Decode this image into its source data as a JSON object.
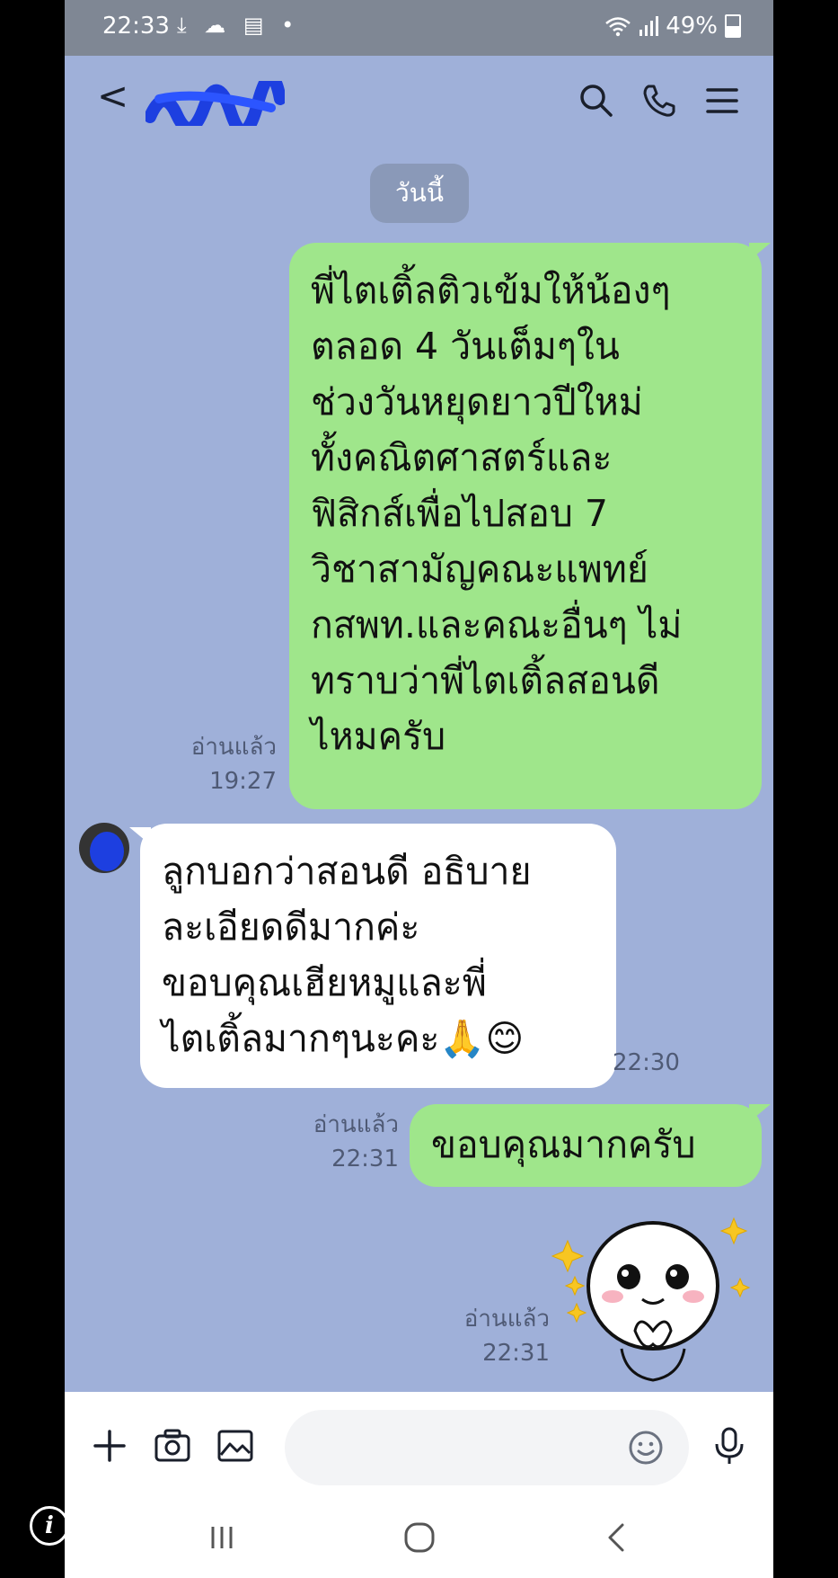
{
  "status_bar": {
    "time": "22:33",
    "left_icons": "⤓ ☁ ▤ •",
    "battery": "49%"
  },
  "header": {
    "back_glyph": "<"
  },
  "date_divider": "วันนี้",
  "messages": [
    {
      "side": "right",
      "lines": [
        "พี่ไตเติ้ลติวเข้มให้น้องๆ",
        "ตลอด 4 วันเต็มๆใน",
        "ช่วงวันหยุดยาวปีใหม่",
        "ทั้งคณิตศาสตร์และ",
        "ฟิสิกส์เพื่อไปสอบ 7",
        "วิชาสามัญคณะแพทย์",
        "กสพท.และคณะอื่นๆ ไม่",
        "ทราบว่าพี่ไตเติ้ลสอนดี",
        "ไหมครับ"
      ],
      "read": "อ่านแล้ว",
      "time": "19:27"
    },
    {
      "side": "left",
      "lines": [
        "ลูกบอกว่าสอนดี อธิบาย",
        "ละเอียดดีมากค่ะ",
        "ขอบคุณเฮียหมูและพี่",
        "ไตเติ้ลมากๆนะคะ🙏😊"
      ],
      "time": "22:30"
    },
    {
      "side": "right",
      "lines": [
        "ขอบคุณมากครับ"
      ],
      "read": "อ่านแล้ว",
      "time": "22:31"
    },
    {
      "side": "right",
      "type": "sticker",
      "read": "อ่านแล้ว",
      "time": "22:31"
    }
  ],
  "icons": {
    "search": "search-icon",
    "call": "phone-icon",
    "menu": "menu-icon",
    "add": "plus-icon",
    "camera": "camera-icon",
    "image": "image-icon",
    "emoji": "emoji-icon",
    "mic": "mic-icon"
  },
  "info_glyph": "i",
  "colors": {
    "chat_background": "#9fb0d9",
    "sent_bubble": "#9fe68b",
    "received_bubble": "#ffffff",
    "status_bar": "#7f8794"
  }
}
